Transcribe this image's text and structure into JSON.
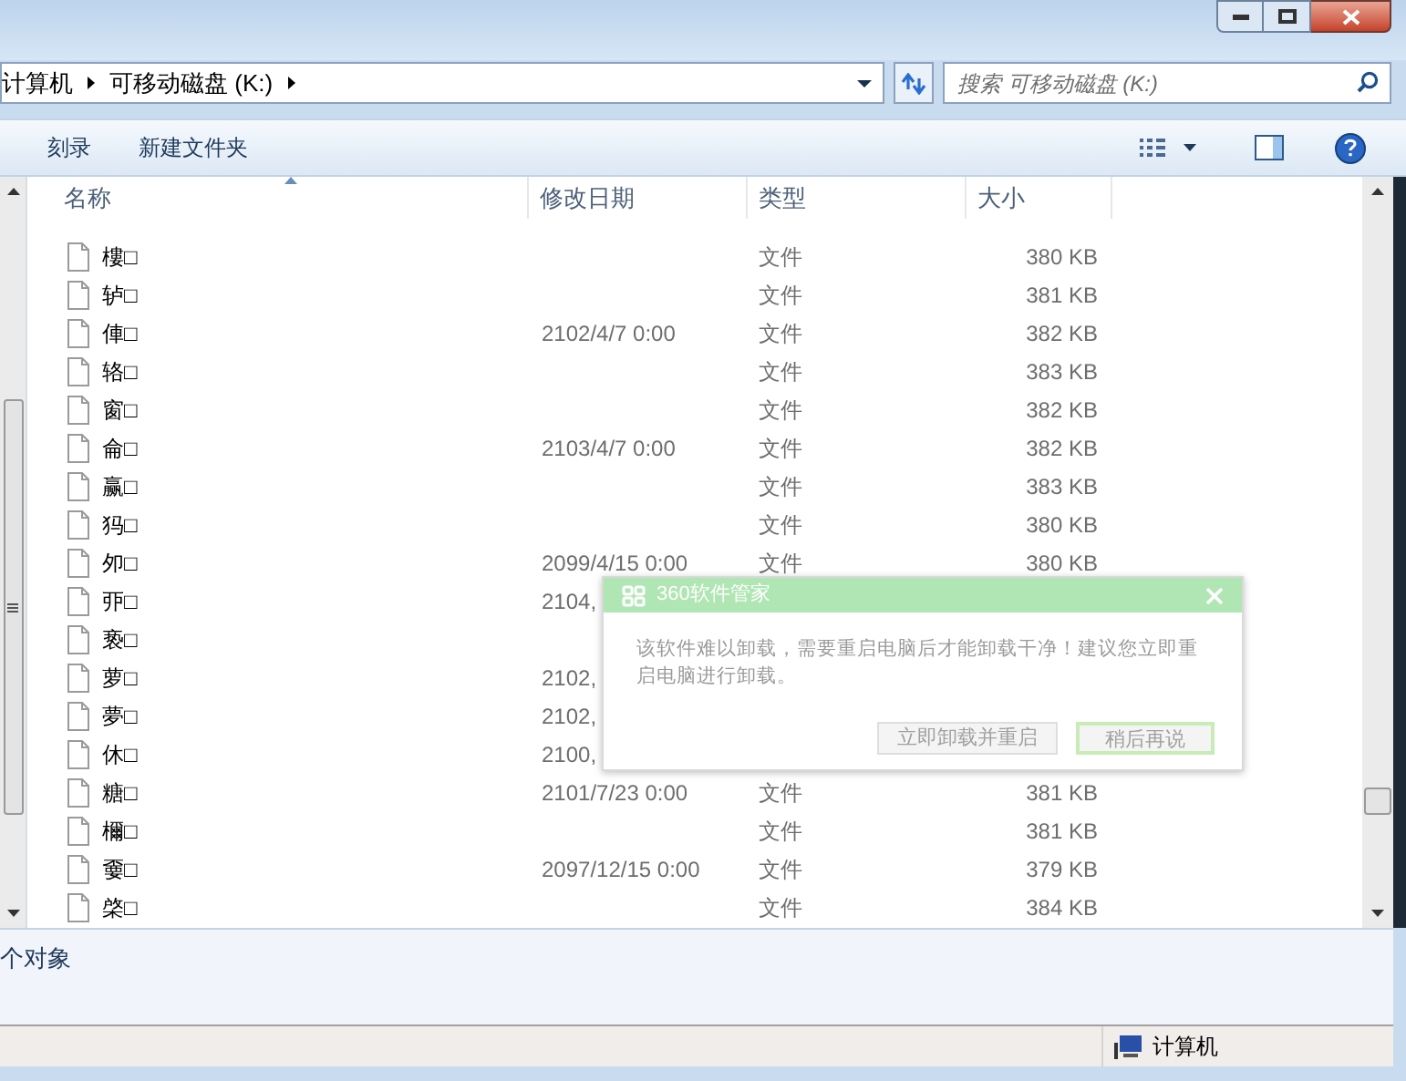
{
  "address": {
    "crumbs": [
      "计算机",
      "可移动磁盘 (K:)"
    ]
  },
  "search": {
    "placeholder": "搜索 可移动磁盘 (K:)"
  },
  "toolbar": {
    "buttons": [
      "刻录",
      "新建文件夹"
    ]
  },
  "table": {
    "columns": [
      "名称",
      "修改日期",
      "类型",
      "大小"
    ],
    "rows": [
      {
        "name": "樓□",
        "date": "",
        "type": "文件",
        "size": "380 KB"
      },
      {
        "name": "轳□",
        "date": "",
        "type": "文件",
        "size": "381 KB"
      },
      {
        "name": "俥□",
        "date": "2102/4/7 0:00",
        "type": "文件",
        "size": "382 KB"
      },
      {
        "name": "辂□",
        "date": "",
        "type": "文件",
        "size": "383 KB"
      },
      {
        "name": "窗□",
        "date": "",
        "type": "文件",
        "size": "382 KB"
      },
      {
        "name": "侖□",
        "date": "2103/4/7 0:00",
        "type": "文件",
        "size": "382 KB"
      },
      {
        "name": "赢□",
        "date": "",
        "type": "文件",
        "size": "383 KB"
      },
      {
        "name": "犸□",
        "date": "",
        "type": "文件",
        "size": "380 KB"
      },
      {
        "name": "夘□",
        "date": "2099/4/15 0:00",
        "type": "文件",
        "size": "380 KB"
      },
      {
        "name": "丣□",
        "date": "2104,",
        "type": "",
        "size": ""
      },
      {
        "name": "亵□",
        "date": "",
        "type": "",
        "size": ""
      },
      {
        "name": "萝□",
        "date": "2102,",
        "type": "",
        "size": ""
      },
      {
        "name": "夢□",
        "date": "2102,",
        "type": "",
        "size": ""
      },
      {
        "name": "休□",
        "date": "2100,",
        "type": "",
        "size": ""
      },
      {
        "name": "糖□",
        "date": "2101/7/23 0:00",
        "type": "文件",
        "size": "381 KB"
      },
      {
        "name": "檷□",
        "date": "",
        "type": "文件",
        "size": "381 KB"
      },
      {
        "name": "嫑□",
        "date": "2097/12/15 0:00",
        "type": "文件",
        "size": "379 KB"
      },
      {
        "name": "棨□",
        "date": "",
        "type": "文件",
        "size": "384 KB"
      }
    ]
  },
  "details": {
    "text": "个对象"
  },
  "status_bar": {
    "location": "计算机"
  },
  "dialog": {
    "title": "360软件管家",
    "message": "该软件难以卸载，需要重启电脑后才能卸载干净！建议您立即重启电脑进行卸载。",
    "buttons": [
      {
        "label": "立即卸载并重启",
        "selected": false
      },
      {
        "label": "稍后再说",
        "selected": true
      }
    ]
  }
}
